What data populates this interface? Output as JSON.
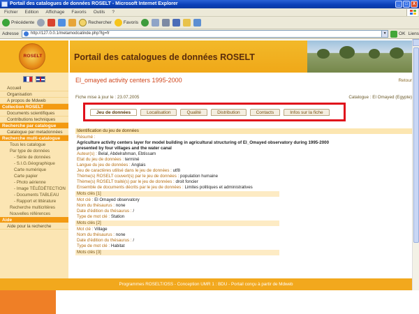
{
  "window": {
    "title": "Portail des catalogues de données ROSELT - Microsoft Internet Explorer",
    "controls": [
      "_",
      "□",
      "X"
    ]
  },
  "menu": [
    "Fichier",
    "Edition",
    "Affichage",
    "Favoris",
    "Outils",
    "?"
  ],
  "toolbar": {
    "back": "Précédente",
    "search": "Rechercher",
    "favorites": "Favoris"
  },
  "address": {
    "label": "Adresse",
    "url": "http://127.0.0.1/metamodcatinde.php?lg=fr",
    "go": "OK",
    "links": "Liens"
  },
  "site": {
    "logo_text": "ROSELT",
    "banner_title": "Portail des catalogues de données ROSELT"
  },
  "sidebar": {
    "items": [
      {
        "type": "item",
        "label": "Accueil"
      },
      {
        "type": "item",
        "label": "Organisation"
      },
      {
        "type": "item",
        "label": "A propos de Mdweb"
      },
      {
        "type": "head",
        "label": "Collection ROSELT"
      },
      {
        "type": "item",
        "label": "Documents scientifiques"
      },
      {
        "type": "item",
        "label": "Contributions techniques"
      },
      {
        "type": "head",
        "label": "Recherche par catalogue"
      },
      {
        "type": "item",
        "label": "Catalogue par metadonnées"
      },
      {
        "type": "head",
        "label": "Recherche multi-catalogue"
      },
      {
        "type": "sub",
        "label": "Tous les catalogue"
      },
      {
        "type": "sub",
        "label": "Par type de données"
      },
      {
        "type": "sub2",
        "label": "- Série de données"
      },
      {
        "type": "sub2",
        "label": "- S.I.G.Géographique"
      },
      {
        "type": "sub2",
        "label": "Carte numérique"
      },
      {
        "type": "sub2",
        "label": "Carte papier"
      },
      {
        "type": "sub2",
        "label": "- Photo aérienne"
      },
      {
        "type": "sub2",
        "label": "- Image TÉLÉDÉTECTION"
      },
      {
        "type": "sub2",
        "label": "- Documents TABLEAU"
      },
      {
        "type": "sub2",
        "label": "- Rapport et littérature"
      },
      {
        "type": "sub",
        "label": "Recherche multicritères"
      },
      {
        "type": "sub",
        "label": "Nouvelles références"
      },
      {
        "type": "head",
        "label": "Aide"
      },
      {
        "type": "item",
        "label": "Aide pour la recherche"
      }
    ]
  },
  "main": {
    "title": "El_omayed activity centers 1995-2000",
    "back": "Retour",
    "meta_left": "Fiche mise à jour le : 23.07.2005",
    "meta_right": "Catalogue : El Omayed (Egypte)",
    "tabs": [
      {
        "label": "Jeu de données",
        "active": true
      },
      {
        "label": "Localisation",
        "active": false
      },
      {
        "label": "Qualité",
        "active": false
      },
      {
        "label": "Distribution",
        "active": false
      },
      {
        "label": "Contacts",
        "active": false
      },
      {
        "label": "Infos sur la fiche",
        "active": false
      }
    ]
  },
  "details": {
    "section_title": "Identification du jeu de données",
    "resume_label": "Résumé :",
    "resume_text": "Agriculture activity centers layer for model building in agricultural structuring of El_Omayed observatory during 1995-2000",
    "resume_text2": "presented by four villages and the water canal",
    "author_label": "Auteur(s) :",
    "author_value": "Belal, Abdelrahman, Ebtissam",
    "status_label": "Etat du jeu de données :",
    "status_value": "terminé",
    "lang_label": "Langue du jeu de données :",
    "lang_value": "Anglais",
    "charset_label": "Jeu de caractères utilisé dans le jeu de données :",
    "charset_value": "utf8",
    "theme_label": "Thème(s) ROSELT couvert(s) par le jeu de données :",
    "theme_value": "population humaine",
    "theme2_label": "Thème(s) ROSELT traité(s) par le jeu de données :",
    "theme2_value": "droit foncier",
    "limits_label": "Ensemble de documents décrits par le jeu de données :",
    "limits_value": "Limites politiques et administratives",
    "kw1_bar": "Mots clés [1]",
    "kw1_word_label": "Mot clé :",
    "kw1_word_value": "El Omayed observatory",
    "kw1_thes_label": "Nom du thésaurus :",
    "kw1_thes_value": "none",
    "kw1_date_label": "Date d'édition du thésaurus :",
    "kw1_date_value": "/",
    "kw1_type_label": "Type de mot clé :",
    "kw1_type_value": "Station",
    "kw2_bar": "Mots clés [2]",
    "kw2_word_label": "Mot clé :",
    "kw2_word_value": "Village",
    "kw2_thes_label": "Nom du thésaurus :",
    "kw2_thes_value": "none",
    "kw2_date_label": "Date d'édition du thésaurus :",
    "kw2_date_value": "/",
    "kw2_type_label": "Type de mot clé :",
    "kw2_type_value": "Habitat",
    "kw3_bar": "Mots clés [3]"
  },
  "footer": {
    "text": "Programmes ROSELT/OSS - Conception UMR 1 : BDU - Portail conçu à partir de Mdweb"
  },
  "colors": {
    "accent_orange": "#f2a81d",
    "title_red": "#d0451b",
    "highlight_box": "#e0101b"
  }
}
